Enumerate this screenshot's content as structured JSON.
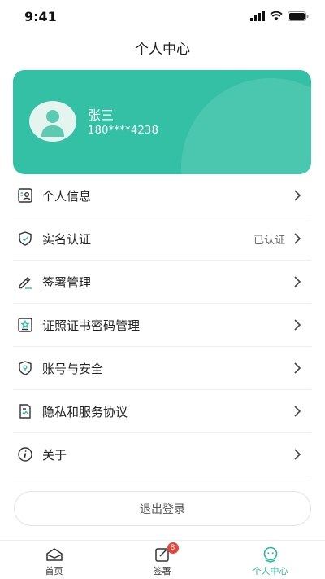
{
  "status_bar": {
    "time": "9:41"
  },
  "header": {
    "title": "个人中心"
  },
  "profile": {
    "name": "张三",
    "phone": "180****4238"
  },
  "menu": {
    "items": [
      {
        "label": "个人信息",
        "icon": "id-card-icon"
      },
      {
        "label": "实名认证",
        "icon": "shield-check-icon",
        "status": "已认证"
      },
      {
        "label": "签署管理",
        "icon": "pen-icon"
      },
      {
        "label": "证照证书密码管理",
        "icon": "certificate-icon"
      },
      {
        "label": "账号与安全",
        "icon": "shield-lock-icon"
      },
      {
        "label": "隐私和服务协议",
        "icon": "agreement-icon"
      },
      {
        "label": "关于",
        "icon": "info-icon"
      }
    ]
  },
  "logout": {
    "label": "退出登录"
  },
  "tabbar": {
    "tabs": [
      {
        "label": "首页",
        "icon": "inbox-icon"
      },
      {
        "label": "签署",
        "icon": "sign-icon",
        "badge": "8"
      },
      {
        "label": "个人中心",
        "icon": "profile-icon",
        "active": true
      }
    ]
  },
  "colors": {
    "accent": "#33c0a5",
    "active_tab": "#2bb89d",
    "badge": "#e5463b"
  }
}
